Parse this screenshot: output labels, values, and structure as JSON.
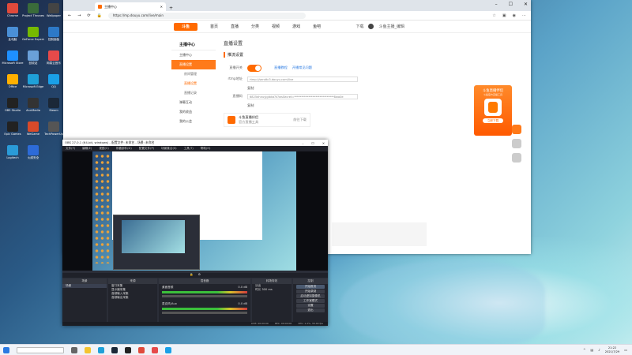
{
  "desktop": {
    "icons": [
      {
        "label": "Chrome",
        "color": "#e04a3b"
      },
      {
        "label": "Project Thrones",
        "color": "#3a6b3a"
      },
      {
        "label": "Wallpaper",
        "color": "#444"
      },
      {
        "label": "此电脑",
        "color": "#4a8fd6"
      },
      {
        "label": "GeForce Experience",
        "color": "#76b900"
      },
      {
        "label": "控制面板",
        "color": "#2d79c7"
      },
      {
        "label": "Microsoft Store",
        "color": "#1e90ff"
      },
      {
        "label": "回收站",
        "color": "#6aa0d8"
      },
      {
        "label": "网易云音乐",
        "color": "#e64a4a"
      },
      {
        "label": "Office",
        "color": "#ffb000"
      },
      {
        "label": "Microsoft Edge",
        "color": "#1fa0d8"
      },
      {
        "label": "QQ",
        "color": "#1aa0e8"
      },
      {
        "label": "OBS Studio",
        "color": "#222"
      },
      {
        "label": "AnnMedia",
        "color": "#333"
      },
      {
        "label": "Steam",
        "color": "#1b2838"
      },
      {
        "label": "Epic Games",
        "color": "#222"
      },
      {
        "label": "WeGame",
        "color": "#d84a2a"
      },
      {
        "label": "TechPowerUp",
        "color": "#555"
      },
      {
        "label": "Logitech",
        "color": "#2a9bd8"
      },
      {
        "label": "火绒安全",
        "color": "#2d6bd8"
      }
    ]
  },
  "browser": {
    "tab_title": "主播中心",
    "url": "https://mp.douyu.com/live/main",
    "logo": "斗鱼",
    "nav": [
      "首页",
      "直播",
      "分类",
      "视频",
      "游戏",
      "鱼吧"
    ],
    "header_right": [
      "下载",
      "斗鱼主播_编辑"
    ],
    "sidebar": {
      "title": "主播中心",
      "items": [
        {
          "label": "主播中心",
          "active": false
        },
        {
          "label": "直播设置",
          "active": true
        },
        {
          "label": "房间管理",
          "sub": true,
          "on": false
        },
        {
          "label": "直播设置",
          "sub": true,
          "on": true
        },
        {
          "label": "直播记录",
          "sub": true,
          "on": false
        },
        {
          "label": "弹幕互动",
          "active": false
        },
        {
          "label": "我的收益",
          "active": false
        },
        {
          "label": "我的公会",
          "active": false
        }
      ]
    },
    "main": {
      "title": "直播设置",
      "section": "推流设置",
      "toggle_label": "直播开关",
      "link1": "直播教程",
      "link2": "开播常见问题",
      "rtmp_label": "rtmp地址",
      "rtmp_value": "rtmp://sendtc3.douyu.com/live",
      "copy": "复制",
      "key_label": "直播码",
      "key_value": "6825dhnuyjgibka?k?wsSecret=****************************8wa0e",
      "tool_title": "斗鱼直播伴侣",
      "tool_sub": "官方直播工具",
      "tool_dl": "前往下载"
    },
    "ad": {
      "title": "斗鱼直播伴侣",
      "sub": "斗鱼官方直播工具",
      "btn": "立即下载"
    }
  },
  "obs": {
    "title": "OBS 27.0.1 (64-bit, windows) - 配置文件: 未命名 - 场景: 未命名",
    "menu": [
      "文件(F)",
      "编辑(E)",
      "视图(V)",
      "停靠部件(D)",
      "配置文件(P)",
      "场景集合(S)",
      "工具(T)",
      "帮助(H)"
    ],
    "docks": {
      "scenes": {
        "title": "场景",
        "items": [
          "场景"
        ]
      },
      "sources": {
        "title": "来源",
        "items": [
          "窗口采集",
          "显示器采集",
          "音频输入采集",
          "音频输出采集"
        ]
      },
      "mixer": {
        "title": "混音器",
        "channels": [
          {
            "name": "桌面音频",
            "db": "0.0 dB"
          },
          {
            "name": "麦克风/Aux",
            "db": "0.0 dB"
          }
        ]
      },
      "transitions": {
        "title": "转场特效",
        "type": "淡出",
        "duration_label": "时长",
        "duration": "300 ms"
      },
      "controls": {
        "title": "控制",
        "buttons": [
          "开始推流",
          "开始录制",
          "启动虚拟摄像机",
          "工作室模式",
          "设置",
          "退出"
        ]
      }
    },
    "status": [
      "LIVE: 00:00:00",
      "REC: 00:00:00",
      "CPU: 1.2%, 30.00 fps"
    ]
  },
  "taskbar": {
    "time": "21:22",
    "date": "2021/7/29"
  }
}
